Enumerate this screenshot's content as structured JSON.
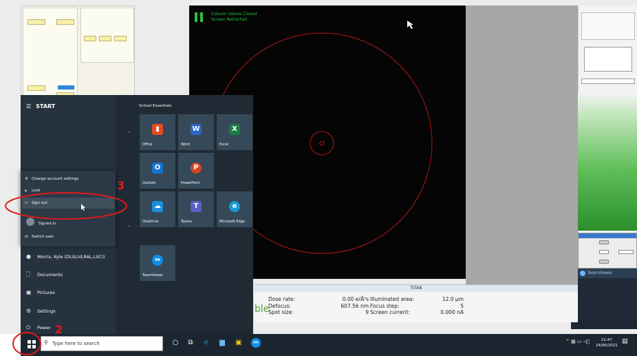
{
  "scope": {
    "status_line1": "Column Valves Closed",
    "status_line2": "Screen Retracted"
  },
  "start_menu": {
    "title": "START",
    "section_title": "School Essentials",
    "account_popup": {
      "change_settings": "Change account settings",
      "lock": "Lock",
      "sign_out": "Sign out",
      "signed_in": "Signed in",
      "switch_user": "Switch user"
    },
    "left_items": [
      {
        "label": "Morris, Kyle (DLSLtd,RAL,LSCI)",
        "icon": "user-icon"
      },
      {
        "label": "Documents",
        "icon": "document-icon"
      },
      {
        "label": "Pictures",
        "icon": "pictures-icon"
      },
      {
        "label": "Settings",
        "icon": "gear-icon"
      },
      {
        "label": "Power",
        "icon": "power-icon"
      }
    ],
    "tiles": [
      {
        "label": "Office",
        "letter": "▮",
        "color": "#e84a1f"
      },
      {
        "label": "Word",
        "letter": "W",
        "color": "#2b66c4"
      },
      {
        "label": "Excel",
        "letter": "X",
        "color": "#1d7a45"
      },
      {
        "label": "Outlook",
        "letter": "O",
        "color": "#1275cf"
      },
      {
        "label": "PowerPoint",
        "letter": "P",
        "color": "#d24726"
      },
      {
        "label": "OneDrive",
        "letter": "☁",
        "color": "#1a8fe0"
      },
      {
        "label": "Teams",
        "letter": "T",
        "color": "#5b5fc7"
      },
      {
        "label": "Microsoft Edge",
        "letter": "e",
        "color": "#1a9ad6"
      },
      {
        "label": "TeamViewer",
        "letter": "⇔",
        "color": "#0e8ee9"
      }
    ]
  },
  "titan": {
    "header": "TITAN",
    "partial_word": "ble",
    "labels_a": [
      "Dose rate:",
      "Defocus:",
      "Spot size:"
    ],
    "values_a": [
      "0.00 e/Å²s",
      "607.56 nm",
      "9"
    ],
    "labels_b": [
      "Illuminated area:",
      "Focus step:",
      "Screen current:"
    ],
    "values_b": [
      "12.0 µm",
      "5",
      "0.000 nA"
    ]
  },
  "teamviewer_panel": {
    "title": "TeamViewer"
  },
  "taskbar": {
    "search_placeholder": "Type here to search",
    "time": "21:47",
    "date": "24/06/2021"
  },
  "annotations": {
    "step2": "2",
    "step3": "3"
  },
  "colors": {
    "annotation": "#e01a1a",
    "taskbar": "#1b2631",
    "start_bg": "#1f2a34"
  }
}
